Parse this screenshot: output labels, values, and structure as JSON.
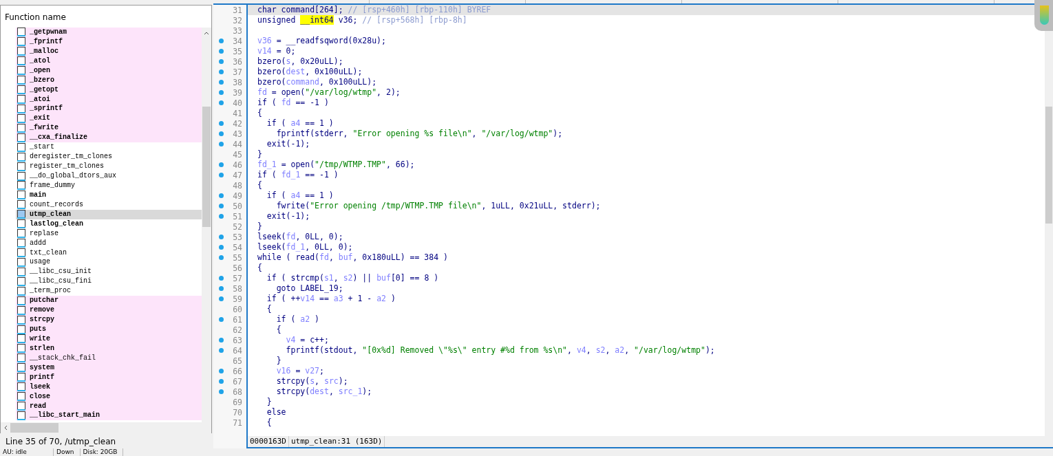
{
  "functions_panel": {
    "column_header": "Function name",
    "functions": [
      {
        "name": "_getpwnam",
        "kind": "import",
        "bold": true,
        "selected": false
      },
      {
        "name": "_fprintf",
        "kind": "import",
        "bold": true,
        "selected": false
      },
      {
        "name": "_malloc",
        "kind": "import",
        "bold": true,
        "selected": false
      },
      {
        "name": "_atol",
        "kind": "import",
        "bold": true,
        "selected": false
      },
      {
        "name": "_open",
        "kind": "import",
        "bold": true,
        "selected": false
      },
      {
        "name": "_bzero",
        "kind": "import",
        "bold": true,
        "selected": false
      },
      {
        "name": "_getopt",
        "kind": "import",
        "bold": true,
        "selected": false
      },
      {
        "name": "_atoi",
        "kind": "import",
        "bold": true,
        "selected": false
      },
      {
        "name": "_sprintf",
        "kind": "import",
        "bold": true,
        "selected": false
      },
      {
        "name": "_exit",
        "kind": "import",
        "bold": true,
        "selected": false
      },
      {
        "name": "_fwrite",
        "kind": "import",
        "bold": true,
        "selected": false
      },
      {
        "name": "__cxa_finalize",
        "kind": "import",
        "bold": true,
        "selected": false
      },
      {
        "name": "_start",
        "kind": "local",
        "bold": false,
        "selected": false
      },
      {
        "name": "deregister_tm_clones",
        "kind": "local",
        "bold": false,
        "selected": false
      },
      {
        "name": "register_tm_clones",
        "kind": "local",
        "bold": false,
        "selected": false
      },
      {
        "name": "__do_global_dtors_aux",
        "kind": "local",
        "bold": false,
        "selected": false
      },
      {
        "name": "frame_dummy",
        "kind": "local",
        "bold": false,
        "selected": false
      },
      {
        "name": "main",
        "kind": "local",
        "bold": true,
        "selected": false
      },
      {
        "name": "count_records",
        "kind": "local",
        "bold": false,
        "selected": false
      },
      {
        "name": "utmp_clean",
        "kind": "local",
        "bold": true,
        "selected": true
      },
      {
        "name": "lastlog_clean",
        "kind": "local",
        "bold": true,
        "selected": false
      },
      {
        "name": "replase",
        "kind": "local",
        "bold": false,
        "selected": false
      },
      {
        "name": "addd",
        "kind": "local",
        "bold": false,
        "selected": false
      },
      {
        "name": "txt_clean",
        "kind": "local",
        "bold": false,
        "selected": false
      },
      {
        "name": "usage",
        "kind": "local",
        "bold": false,
        "selected": false
      },
      {
        "name": "__libc_csu_init",
        "kind": "local",
        "bold": false,
        "selected": false
      },
      {
        "name": "__libc_csu_fini",
        "kind": "local",
        "bold": false,
        "selected": false
      },
      {
        "name": "_term_proc",
        "kind": "local",
        "bold": false,
        "selected": false
      },
      {
        "name": "putchar",
        "kind": "import",
        "bold": true,
        "selected": false
      },
      {
        "name": "remove",
        "kind": "import",
        "bold": true,
        "selected": false
      },
      {
        "name": "strcpy",
        "kind": "import",
        "bold": true,
        "selected": false
      },
      {
        "name": "puts",
        "kind": "import",
        "bold": true,
        "selected": false
      },
      {
        "name": "write",
        "kind": "import",
        "bold": true,
        "selected": false
      },
      {
        "name": "strlen",
        "kind": "import",
        "bold": true,
        "selected": false
      },
      {
        "name": "__stack_chk_fail",
        "kind": "import",
        "bold": false,
        "selected": false
      },
      {
        "name": "system",
        "kind": "import",
        "bold": true,
        "selected": false
      },
      {
        "name": "printf",
        "kind": "import",
        "bold": true,
        "selected": false
      },
      {
        "name": "lseek",
        "kind": "import",
        "bold": true,
        "selected": false
      },
      {
        "name": "close",
        "kind": "import",
        "bold": true,
        "selected": false
      },
      {
        "name": "read",
        "kind": "import",
        "bold": true,
        "selected": false
      },
      {
        "name": "__libc_start_main",
        "kind": "import",
        "bold": true,
        "selected": false
      }
    ],
    "line_info": "Line 35 of 70, /utmp_clean"
  },
  "pseudocode": {
    "lines": [
      {
        "number": "31",
        "breakpoint": false,
        "selected": true,
        "segments": [
          {
            "kind": "code",
            "text": "char command[264]; "
          },
          {
            "kind": "comment",
            "text": "// [rsp+460h] [rbp-110h] BYREF"
          }
        ]
      },
      {
        "number": "32",
        "breakpoint": false,
        "selected": false,
        "segments": [
          {
            "kind": "code",
            "text": "unsigned "
          },
          {
            "kind": "highlight",
            "text": "__int64"
          },
          {
            "kind": "code",
            "text": " v36; "
          },
          {
            "kind": "comment",
            "text": "// [rsp+568h] [rbp-8h]"
          }
        ]
      },
      {
        "number": "33",
        "breakpoint": false,
        "selected": false
      },
      {
        "number": "34",
        "breakpoint": true,
        "selected": false,
        "segments": [
          {
            "kind": "var",
            "text": "v36"
          },
          {
            "kind": "code",
            "text": " = __readfsqword(0x28u);"
          }
        ]
      },
      {
        "number": "35",
        "breakpoint": true,
        "selected": false,
        "segments": [
          {
            "kind": "var",
            "text": "v14"
          },
          {
            "kind": "code",
            "text": " = 0;"
          }
        ]
      },
      {
        "number": "36",
        "breakpoint": true,
        "selected": false,
        "segments": [
          {
            "kind": "code",
            "text": "bzero("
          },
          {
            "kind": "var",
            "text": "s"
          },
          {
            "kind": "code",
            "text": ", 0x20uLL);"
          }
        ]
      },
      {
        "number": "37",
        "breakpoint": true,
        "selected": false,
        "segments": [
          {
            "kind": "code",
            "text": "bzero("
          },
          {
            "kind": "var",
            "text": "dest"
          },
          {
            "kind": "code",
            "text": ", 0x100uLL);"
          }
        ]
      },
      {
        "number": "38",
        "breakpoint": true,
        "selected": false,
        "segments": [
          {
            "kind": "code",
            "text": "bzero("
          },
          {
            "kind": "var",
            "text": "command"
          },
          {
            "kind": "code",
            "text": ", 0x100uLL);"
          }
        ]
      },
      {
        "number": "39",
        "breakpoint": true,
        "selected": false,
        "segments": [
          {
            "kind": "var",
            "text": "fd"
          },
          {
            "kind": "code",
            "text": " = open("
          },
          {
            "kind": "string",
            "text": "\"/var/log/wtmp\""
          },
          {
            "kind": "code",
            "text": ", 2);"
          }
        ]
      },
      {
        "number": "40",
        "breakpoint": true,
        "selected": false,
        "segments": [
          {
            "kind": "code",
            "text": "if ( "
          },
          {
            "kind": "var",
            "text": "fd"
          },
          {
            "kind": "code",
            "text": " == -1 )"
          }
        ]
      },
      {
        "number": "41",
        "breakpoint": false,
        "selected": false,
        "segments": [
          {
            "kind": "code",
            "text": "{"
          }
        ]
      },
      {
        "number": "42",
        "breakpoint": true,
        "selected": false,
        "segments": [
          {
            "kind": "code",
            "text": "  if ( "
          },
          {
            "kind": "var",
            "text": "a4"
          },
          {
            "kind": "code",
            "text": " == 1 )"
          }
        ]
      },
      {
        "number": "43",
        "breakpoint": true,
        "selected": false,
        "segments": [
          {
            "kind": "code",
            "text": "    fprintf(stderr, "
          },
          {
            "kind": "string",
            "text": "\"Error opening %s file\\n\""
          },
          {
            "kind": "code",
            "text": ", "
          },
          {
            "kind": "string",
            "text": "\"/var/log/wtmp\""
          },
          {
            "kind": "code",
            "text": ");"
          }
        ]
      },
      {
        "number": "44",
        "breakpoint": true,
        "selected": false,
        "segments": [
          {
            "kind": "code",
            "text": "  exit(-1);"
          }
        ]
      },
      {
        "number": "45",
        "breakpoint": false,
        "selected": false,
        "segments": [
          {
            "kind": "code",
            "text": "}"
          }
        ]
      },
      {
        "number": "46",
        "breakpoint": true,
        "selected": false,
        "segments": [
          {
            "kind": "var",
            "text": "fd_1"
          },
          {
            "kind": "code",
            "text": " = open("
          },
          {
            "kind": "string",
            "text": "\"/tmp/WTMP.TMP\""
          },
          {
            "kind": "code",
            "text": ", 66);"
          }
        ]
      },
      {
        "number": "47",
        "breakpoint": true,
        "selected": false,
        "segments": [
          {
            "kind": "code",
            "text": "if ( "
          },
          {
            "kind": "var",
            "text": "fd_1"
          },
          {
            "kind": "code",
            "text": " == -1 )"
          }
        ]
      },
      {
        "number": "48",
        "breakpoint": false,
        "selected": false,
        "segments": [
          {
            "kind": "code",
            "text": "{"
          }
        ]
      },
      {
        "number": "49",
        "breakpoint": true,
        "selected": false,
        "segments": [
          {
            "kind": "code",
            "text": "  if ( "
          },
          {
            "kind": "var",
            "text": "a4"
          },
          {
            "kind": "code",
            "text": " == 1 )"
          }
        ]
      },
      {
        "number": "50",
        "breakpoint": true,
        "selected": false,
        "segments": [
          {
            "kind": "code",
            "text": "    fwrite("
          },
          {
            "kind": "string",
            "text": "\"Error opening /tmp/WTMP.TMP file\\n\""
          },
          {
            "kind": "code",
            "text": ", 1uLL, 0x21uLL, stderr);"
          }
        ]
      },
      {
        "number": "51",
        "breakpoint": true,
        "selected": false,
        "segments": [
          {
            "kind": "code",
            "text": "  exit(-1);"
          }
        ]
      },
      {
        "number": "52",
        "breakpoint": false,
        "selected": false,
        "segments": [
          {
            "kind": "code",
            "text": "}"
          }
        ]
      },
      {
        "number": "53",
        "breakpoint": true,
        "selected": false,
        "segments": [
          {
            "kind": "code",
            "text": "lseek("
          },
          {
            "kind": "var",
            "text": "fd"
          },
          {
            "kind": "code",
            "text": ", 0LL, 0);"
          }
        ]
      },
      {
        "number": "54",
        "breakpoint": true,
        "selected": false,
        "segments": [
          {
            "kind": "code",
            "text": "lseek("
          },
          {
            "kind": "var",
            "text": "fd_1"
          },
          {
            "kind": "code",
            "text": ", 0LL, 0);"
          }
        ]
      },
      {
        "number": "55",
        "breakpoint": true,
        "selected": false,
        "segments": [
          {
            "kind": "code",
            "text": "while ( read("
          },
          {
            "kind": "var",
            "text": "fd"
          },
          {
            "kind": "code",
            "text": ", "
          },
          {
            "kind": "var",
            "text": "buf"
          },
          {
            "kind": "code",
            "text": ", 0x180uLL) == 384 )"
          }
        ]
      },
      {
        "number": "56",
        "breakpoint": false,
        "selected": false,
        "segments": [
          {
            "kind": "code",
            "text": "{"
          }
        ]
      },
      {
        "number": "57",
        "breakpoint": true,
        "selected": false,
        "segments": [
          {
            "kind": "code",
            "text": "  if ( strcmp("
          },
          {
            "kind": "var",
            "text": "s1"
          },
          {
            "kind": "code",
            "text": ", "
          },
          {
            "kind": "var",
            "text": "s2"
          },
          {
            "kind": "code",
            "text": ") || "
          },
          {
            "kind": "var",
            "text": "buf"
          },
          {
            "kind": "code",
            "text": "[0] == 8 )"
          }
        ]
      },
      {
        "number": "58",
        "breakpoint": true,
        "selected": false,
        "segments": [
          {
            "kind": "code",
            "text": "    goto LABEL_19;"
          }
        ]
      },
      {
        "number": "59",
        "breakpoint": true,
        "selected": false,
        "segments": [
          {
            "kind": "code",
            "text": "  if ( ++"
          },
          {
            "kind": "var",
            "text": "v14"
          },
          {
            "kind": "code",
            "text": " == "
          },
          {
            "kind": "var",
            "text": "a3"
          },
          {
            "kind": "code",
            "text": " + 1 - "
          },
          {
            "kind": "var",
            "text": "a2"
          },
          {
            "kind": "code",
            "text": " )"
          }
        ]
      },
      {
        "number": "60",
        "breakpoint": false,
        "selected": false,
        "segments": [
          {
            "kind": "code",
            "text": "  {"
          }
        ]
      },
      {
        "number": "61",
        "breakpoint": true,
        "selected": false,
        "segments": [
          {
            "kind": "code",
            "text": "    if ( "
          },
          {
            "kind": "var",
            "text": "a2"
          },
          {
            "kind": "code",
            "text": " )"
          }
        ]
      },
      {
        "number": "62",
        "breakpoint": false,
        "selected": false,
        "segments": [
          {
            "kind": "code",
            "text": "    {"
          }
        ]
      },
      {
        "number": "63",
        "breakpoint": true,
        "selected": false,
        "segments": [
          {
            "kind": "var",
            "text": "      v4"
          },
          {
            "kind": "code",
            "text": " = c++;"
          }
        ]
      },
      {
        "number": "64",
        "breakpoint": true,
        "selected": false,
        "segments": [
          {
            "kind": "code",
            "text": "      fprintf(stdout, "
          },
          {
            "kind": "string",
            "text": "\"[0x%d] Removed \\\"%s\\\" entry #%d from %s\\n\""
          },
          {
            "kind": "code",
            "text": ", "
          },
          {
            "kind": "var",
            "text": "v4"
          },
          {
            "kind": "code",
            "text": ", "
          },
          {
            "kind": "var",
            "text": "s2"
          },
          {
            "kind": "code",
            "text": ", "
          },
          {
            "kind": "var",
            "text": "a2"
          },
          {
            "kind": "code",
            "text": ", "
          },
          {
            "kind": "string",
            "text": "\"/var/log/wtmp\""
          },
          {
            "kind": "code",
            "text": ");"
          }
        ]
      },
      {
        "number": "65",
        "breakpoint": false,
        "selected": false,
        "segments": [
          {
            "kind": "code",
            "text": "    }"
          }
        ]
      },
      {
        "number": "66",
        "breakpoint": true,
        "selected": false,
        "segments": [
          {
            "kind": "var",
            "text": "    v16"
          },
          {
            "kind": "code",
            "text": " = "
          },
          {
            "kind": "var",
            "text": "v27"
          },
          {
            "kind": "code",
            "text": ";"
          }
        ]
      },
      {
        "number": "67",
        "breakpoint": true,
        "selected": false,
        "segments": [
          {
            "kind": "code",
            "text": "    strcpy("
          },
          {
            "kind": "var",
            "text": "s"
          },
          {
            "kind": "code",
            "text": ", "
          },
          {
            "kind": "var",
            "text": "src"
          },
          {
            "kind": "code",
            "text": ");"
          }
        ]
      },
      {
        "number": "68",
        "breakpoint": true,
        "selected": false,
        "segments": [
          {
            "kind": "code",
            "text": "    strcpy("
          },
          {
            "kind": "var",
            "text": "dest"
          },
          {
            "kind": "code",
            "text": ", "
          },
          {
            "kind": "var",
            "text": "src_1"
          },
          {
            "kind": "code",
            "text": ");"
          }
        ]
      },
      {
        "number": "69",
        "breakpoint": false,
        "selected": false,
        "segments": [
          {
            "kind": "code",
            "text": "  }"
          }
        ]
      },
      {
        "number": "70",
        "breakpoint": false,
        "selected": false,
        "segments": [
          {
            "kind": "code",
            "text": "  else"
          }
        ]
      },
      {
        "number": "71",
        "breakpoint": false,
        "selected": false,
        "segments": [
          {
            "kind": "code",
            "text": "  {"
          }
        ]
      }
    ],
    "status": {
      "address": "0000163D",
      "location": "utmp_clean:31 (163D)"
    }
  },
  "status_bar": [
    "AU: idle",
    "Down",
    "Disk: 20GB"
  ]
}
